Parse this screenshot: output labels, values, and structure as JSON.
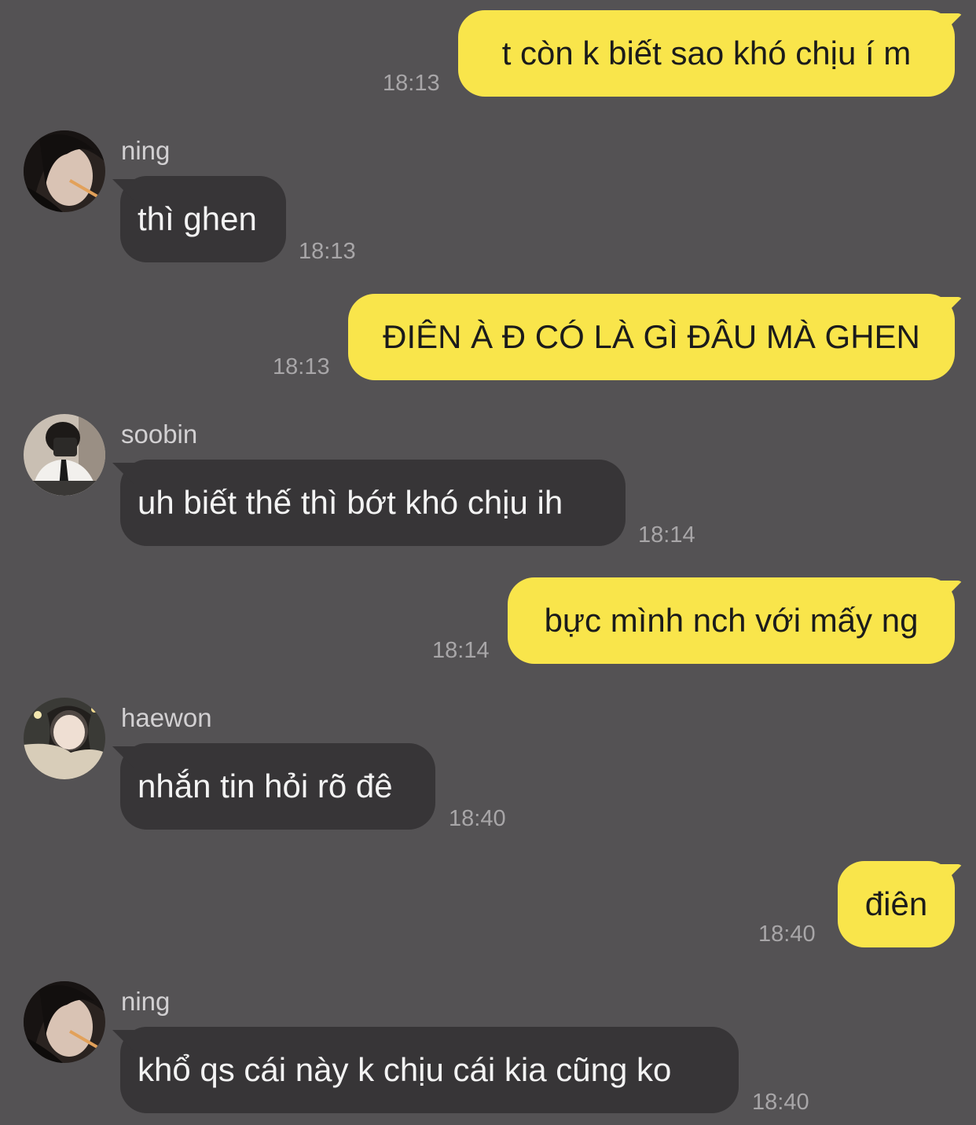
{
  "colors": {
    "background": "#545254",
    "outgoing_bubble": "#F9E54B",
    "incoming_bubble": "#373537",
    "timestamp": "#a8a6a8"
  },
  "messages": [
    {
      "direction": "outgoing",
      "text": "t còn k biết sao khó chịu í m",
      "time": "18:13"
    },
    {
      "direction": "incoming",
      "sender": "ning",
      "avatar": "avatar-photo-ning",
      "text": "thì ghen",
      "time": "18:13"
    },
    {
      "direction": "outgoing",
      "text": "ĐIÊN À Đ CÓ LÀ GÌ ĐÂU MÀ GHEN",
      "time": "18:13"
    },
    {
      "direction": "incoming",
      "sender": "soobin",
      "avatar": "avatar-photo-soobin",
      "text": "uh biết thế thì bớt khó chịu ih",
      "time": "18:14"
    },
    {
      "direction": "outgoing",
      "text": "bực mình nch với mấy ng",
      "time": "18:14"
    },
    {
      "direction": "incoming",
      "sender": "haewon",
      "avatar": "avatar-photo-haewon",
      "text": "nhắn tin hỏi rõ đê",
      "time": "18:40"
    },
    {
      "direction": "outgoing",
      "text": "điên",
      "time": "18:40"
    },
    {
      "direction": "incoming",
      "sender": "ning",
      "avatar": "avatar-photo-ning",
      "text": "khổ qs cái này k chịu cái kia cũng ko",
      "time": "18:40"
    }
  ]
}
